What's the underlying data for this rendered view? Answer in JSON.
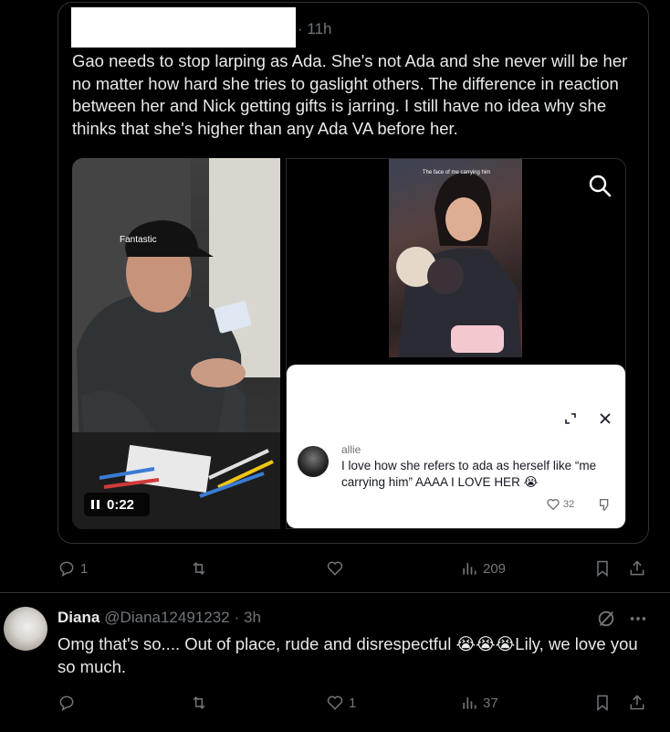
{
  "quote": {
    "time": "· 11h",
    "text": "Gao needs to stop larping as Ada. She's not Ada and she never will be her no matter how hard she tries to gaslight others. The difference in reaction between her and Nick getting gifts is jarring. I still have no idea why she thinks that she's higher than any Ada VA before her.",
    "video_time": "0:22",
    "cap_text": "Fantastic",
    "photo_caption": "The face of me carrying him",
    "comment": {
      "username": "allie",
      "text": "I love how she refers to ada as herself like “me carrying him” AAAA I LOVE HER 😭",
      "likes": "32"
    },
    "actions": {
      "replies": "1",
      "reposts": "",
      "likes": "",
      "views": "209"
    }
  },
  "reply": {
    "name": "Diana",
    "handle": "@Diana12491232",
    "time": "· 3h",
    "text": "Omg that's so.... Out of place, rude and disrespectful 😭😭😭Lily, we love you so much.",
    "actions": {
      "replies": "",
      "reposts": "",
      "likes": "1",
      "views": "37"
    }
  },
  "colors": {
    "background": "#000000",
    "text": "#e7e9ea",
    "muted": "#71767b",
    "border": "#2f3336"
  }
}
